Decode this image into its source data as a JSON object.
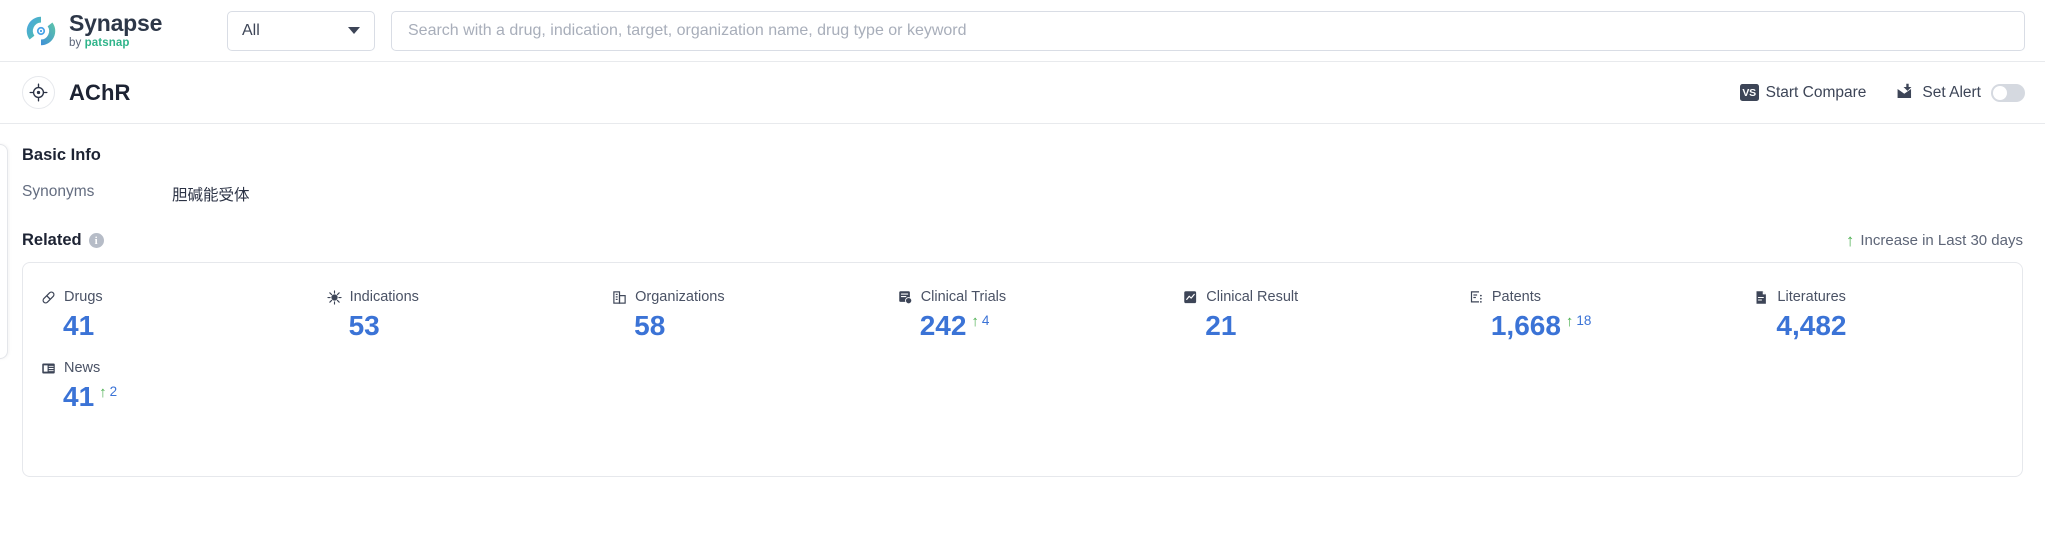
{
  "topbar": {
    "logo_name": "Synapse",
    "logo_by": "by ",
    "logo_brand": "patsnap",
    "category_select": "All",
    "search_placeholder": "Search with a drug, indication, target, organization name, drug type or keyword",
    "search_value": ""
  },
  "titlebar": {
    "title": "AChR",
    "start_compare": "Start Compare",
    "vs_badge": "VS",
    "set_alert": "Set Alert",
    "alert_enabled": false
  },
  "basic_info": {
    "heading": "Basic Info",
    "rows": [
      {
        "key": "Synonyms",
        "value": "胆碱能受体"
      }
    ]
  },
  "related": {
    "heading": "Related",
    "info_icon_char": "i",
    "increase_note": "Increase in Last 30 days",
    "increase_arrow": "↑",
    "stats": [
      {
        "label": "Drugs",
        "icon": "pill-icon",
        "value": "41",
        "delta": null
      },
      {
        "label": "Indications",
        "icon": "virus-icon",
        "value": "53",
        "delta": null
      },
      {
        "label": "Organizations",
        "icon": "building-icon",
        "value": "58",
        "delta": null
      },
      {
        "label": "Clinical Trials",
        "icon": "clinical-trial-icon",
        "value": "242",
        "delta": "4"
      },
      {
        "label": "Clinical Result",
        "icon": "clinical-result-icon",
        "value": "21",
        "delta": null
      },
      {
        "label": "Patents",
        "icon": "patent-icon",
        "value": "1,668",
        "delta": "18"
      },
      {
        "label": "Literatures",
        "icon": "literature-icon",
        "value": "4,482",
        "delta": null
      },
      {
        "label": "News",
        "icon": "news-icon",
        "value": "41",
        "delta": "2"
      }
    ]
  },
  "colors": {
    "accent_blue": "#3b73d6",
    "increase_green": "#4caf50",
    "text_dark": "#1d2333",
    "text_muted": "#646d80",
    "border": "#e6e8ec"
  }
}
